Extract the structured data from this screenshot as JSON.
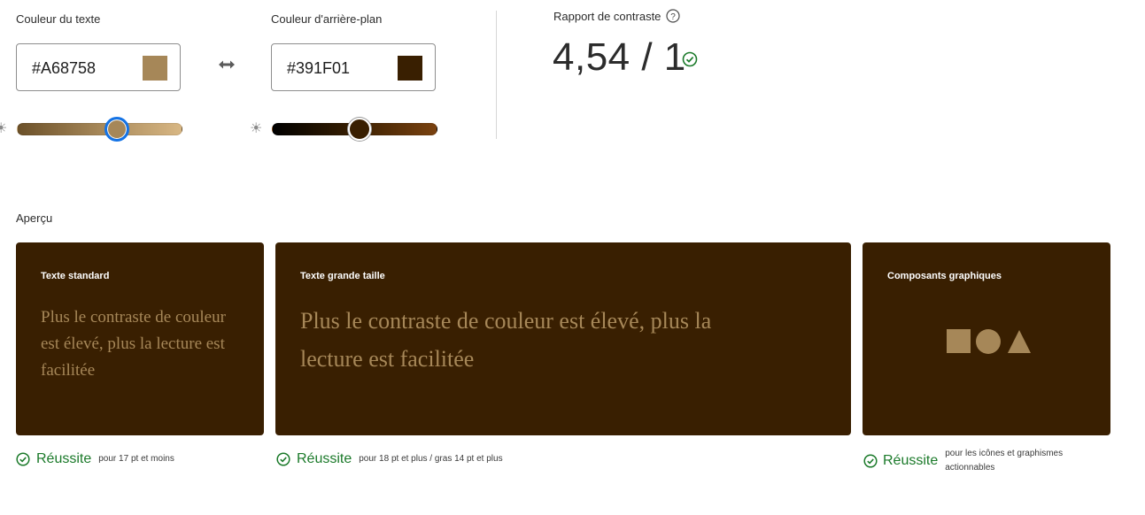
{
  "text_color": {
    "label": "Couleur du texte",
    "value": "#A68758",
    "swatch": "#a68758",
    "slider_fraction": 0.6
  },
  "swap_icon": "swap-arrows-icon",
  "bg_color": {
    "label": "Couleur d'arrière-plan",
    "value": "#391F01",
    "swatch": "#391f01",
    "slider_fraction": 0.53
  },
  "contrast": {
    "label": "Rapport de contraste",
    "help_icon": "help-icon",
    "ratio": "4,54 / 1",
    "status_icon": "check-circle-icon"
  },
  "preview": {
    "label": "Aperçu",
    "cards": [
      {
        "title": "Texte standard",
        "sample": "Plus le contraste de couleur est élevé, plus la lecture est facilitée",
        "status": "Réussite",
        "note": "pour 17 pt et moins"
      },
      {
        "title": "Texte grande taille",
        "sample": "Plus le contraste de couleur est élevé, plus la lecture est facilitée",
        "status": "Réussite",
        "note": "pour 18 pt et plus / gras 14 pt et plus"
      },
      {
        "title": "Composants graphiques",
        "shapes": [
          "square-shape-icon",
          "circle-shape-icon",
          "triangle-shape-icon"
        ],
        "status": "Réussite",
        "note": "pour les icônes et graphismes actionnables"
      }
    ]
  },
  "colors": {
    "text_color": "#a68758",
    "background": "#391f01",
    "pass_green": "#1b7a2a",
    "focus_ring": "#1473e6"
  }
}
